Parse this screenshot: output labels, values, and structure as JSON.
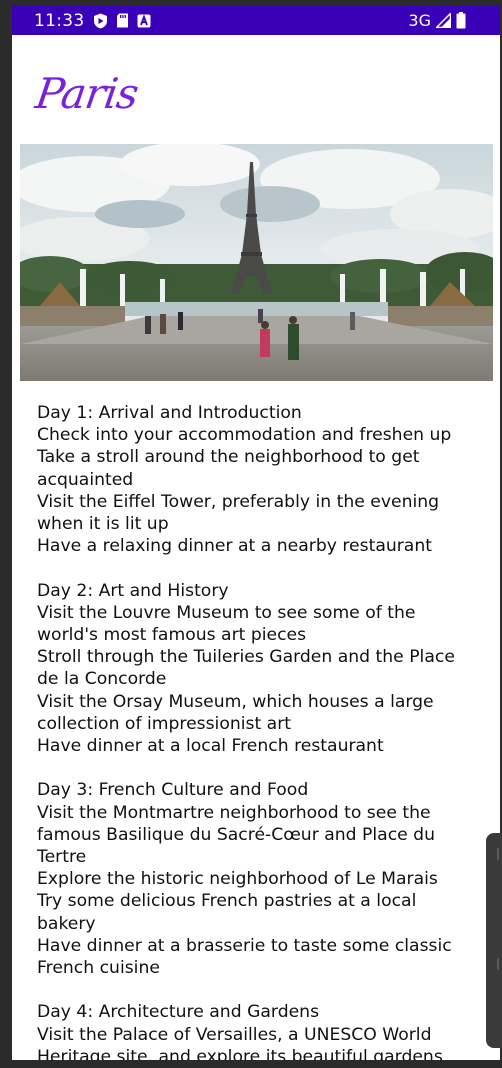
{
  "status_bar": {
    "time": "11:33",
    "left_icons": [
      "shield-play-icon",
      "sd-card-icon",
      "a-badge-icon"
    ],
    "network": "3G",
    "right_icons": [
      "signal-icon",
      "battery-icon"
    ],
    "background": "#3a00b8"
  },
  "header": {
    "title": "Paris",
    "title_color": "#7a22d9"
  },
  "hero": {
    "image_name": "eiffel-tower-photo"
  },
  "itinerary": [
    {
      "heading": "Day 1: Arrival and Introduction",
      "items": [
        "Check into your accommodation and freshen up",
        "Take a stroll around the neighborhood to get acquainted",
        "Visit the Eiffel Tower, preferably in the evening when it is lit up",
        "Have a relaxing dinner at a nearby restaurant"
      ]
    },
    {
      "heading": "Day 2: Art and History",
      "items": [
        "Visit the Louvre Museum to see some of the world's most famous art pieces",
        "Stroll through the Tuileries Garden and the Place de la Concorde",
        "Visit the Orsay Museum, which houses a large collection of impressionist art",
        "Have dinner at a local French restaurant"
      ]
    },
    {
      "heading": "Day 3: French Culture and Food",
      "items": [
        "Visit the Montmartre neighborhood to see the famous Basilique du Sacré-Cœur and Place du Tertre",
        "Explore the historic neighborhood of Le Marais",
        "Try some delicious French pastries at a local bakery",
        "Have dinner at a brasserie to taste some classic French cuisine"
      ]
    },
    {
      "heading": "Day 4: Architecture and Gardens",
      "items": [
        "Visit the Palace of Versailles, a UNESCO World Heritage site, and explore its beautiful gardens"
      ]
    }
  ]
}
